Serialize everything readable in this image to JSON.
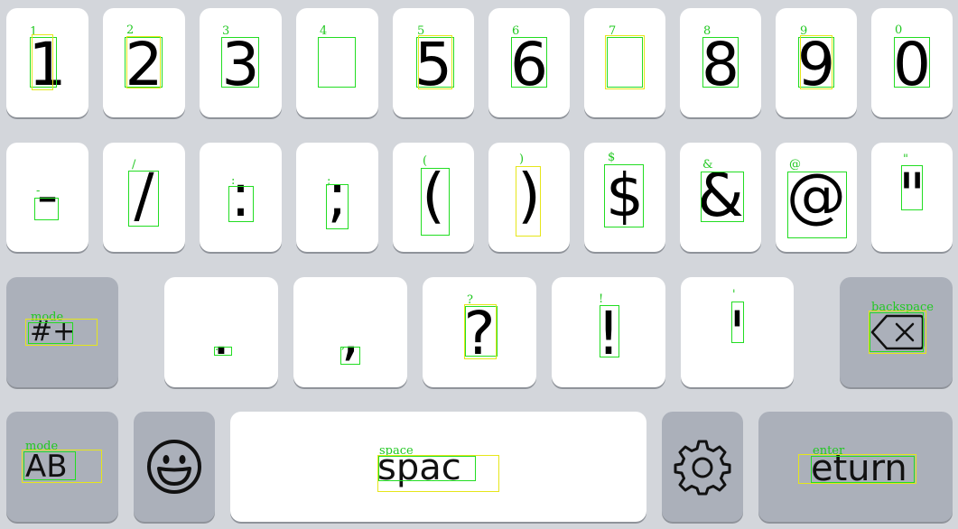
{
  "keyboard": {
    "row1": [
      {
        "hint": "1",
        "glyph": "1"
      },
      {
        "hint": "2",
        "glyph": "2"
      },
      {
        "hint": "3",
        "glyph": "3"
      },
      {
        "hint": "4",
        "glyph": ""
      },
      {
        "hint": "5",
        "glyph": "5"
      },
      {
        "hint": "6",
        "glyph": "6"
      },
      {
        "hint": "7",
        "glyph": ""
      },
      {
        "hint": "8",
        "glyph": "8"
      },
      {
        "hint": "9",
        "glyph": "9"
      },
      {
        "hint": "0",
        "glyph": "0"
      }
    ],
    "row2": [
      {
        "hint": "-",
        "glyph": "-"
      },
      {
        "hint": "/",
        "glyph": "/"
      },
      {
        "hint": ":",
        "glyph": ":"
      },
      {
        "hint": ";",
        "glyph": ";"
      },
      {
        "hint": "(",
        "glyph": "("
      },
      {
        "hint": ")",
        "glyph": ")"
      },
      {
        "hint": "$",
        "glyph": "$"
      },
      {
        "hint": "&",
        "glyph": "&"
      },
      {
        "hint": "@",
        "glyph": "@"
      },
      {
        "hint": "\"",
        "glyph": "\""
      }
    ],
    "row3": {
      "mode_hint": "mode",
      "mode_label": "#+",
      "keys": [
        {
          "hint": ".",
          "glyph": "."
        },
        {
          "hint": ",",
          "glyph": ","
        },
        {
          "hint": "?",
          "glyph": "?"
        },
        {
          "hint": "!",
          "glyph": "!"
        },
        {
          "hint": "'",
          "glyph": "'"
        }
      ],
      "backspace_hint": "backspace",
      "backspace_icon": "backspace-icon"
    },
    "row4": {
      "mode_hint": "mode",
      "mode_label": "AB",
      "emoji_icon": "emoji-icon",
      "space_hint": "space",
      "space_label": "spac",
      "settings_icon": "gear-icon",
      "enter_hint": "enter",
      "enter_label": "eturn"
    }
  },
  "colors": {
    "background": "#d3d6db",
    "key": "#ffffff",
    "function_key": "#abb0ba",
    "annotation_green": "#22dd22",
    "annotation_yellow": "#e6e61a"
  }
}
